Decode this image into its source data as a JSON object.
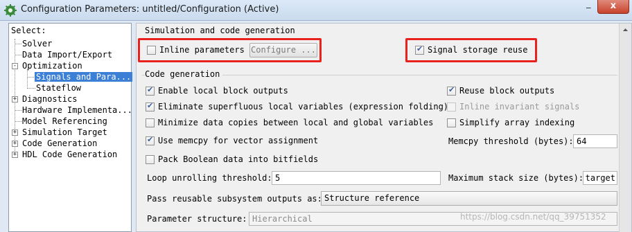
{
  "window": {
    "title": "Configuration Parameters: untitled/Configuration (Active)",
    "close_glyph": "x",
    "minimize_glyph": "_"
  },
  "colors": {
    "highlight": "#e8211d",
    "selection": "#3b7fd6"
  },
  "icons": {
    "app": "simulink-gear-icon",
    "expander_open": "-",
    "expander_closed": "+"
  },
  "tree": {
    "title": "Select:",
    "items": [
      {
        "label": "Solver"
      },
      {
        "label": "Data Import/Export"
      },
      {
        "label": "Optimization"
      },
      {
        "label": "Signals and Para..."
      },
      {
        "label": "Stateflow"
      },
      {
        "label": "Diagnostics"
      },
      {
        "label": "Hardware Implementa..."
      },
      {
        "label": "Model Referencing"
      },
      {
        "label": "Simulation Target"
      },
      {
        "label": "Code Generation"
      },
      {
        "label": "HDL Code Generation"
      }
    ]
  },
  "sim": {
    "group": "Simulation and code generation",
    "inline_params": {
      "label": "Inline parameters",
      "checked": false
    },
    "configure": "Configure ...",
    "signal_storage": {
      "label": "Signal storage reuse",
      "checked": true
    }
  },
  "codegen": {
    "group": "Code generation",
    "enable_local": "Enable local block outputs",
    "reuse_block": "Reuse block outputs",
    "eliminate": "Eliminate superfluous local variables (expression folding)",
    "inline_invariant": "Inline invariant signals",
    "minimize": "Minimize data copies between local and global variables",
    "simplify": "Simplify array indexing",
    "memcpy": "Use memcpy for vector assignment",
    "memcpy_threshold_label": "Memcpy threshold (bytes):",
    "memcpy_threshold_value": "64",
    "pack_boolean": "Pack Boolean data into bitfields",
    "loop_label": "Loop unrolling threshold:",
    "loop_value": "5",
    "max_stack_label": "Maximum stack size (bytes):",
    "max_stack_value": "Inherit from target",
    "pass_label": "Pass reusable subsystem outputs as:",
    "pass_value": "Structure reference",
    "param_struct_label": "Parameter structure:",
    "param_struct_value": "Hierarchical"
  },
  "watermark": "https://blog.csdn.net/qq_39751352"
}
